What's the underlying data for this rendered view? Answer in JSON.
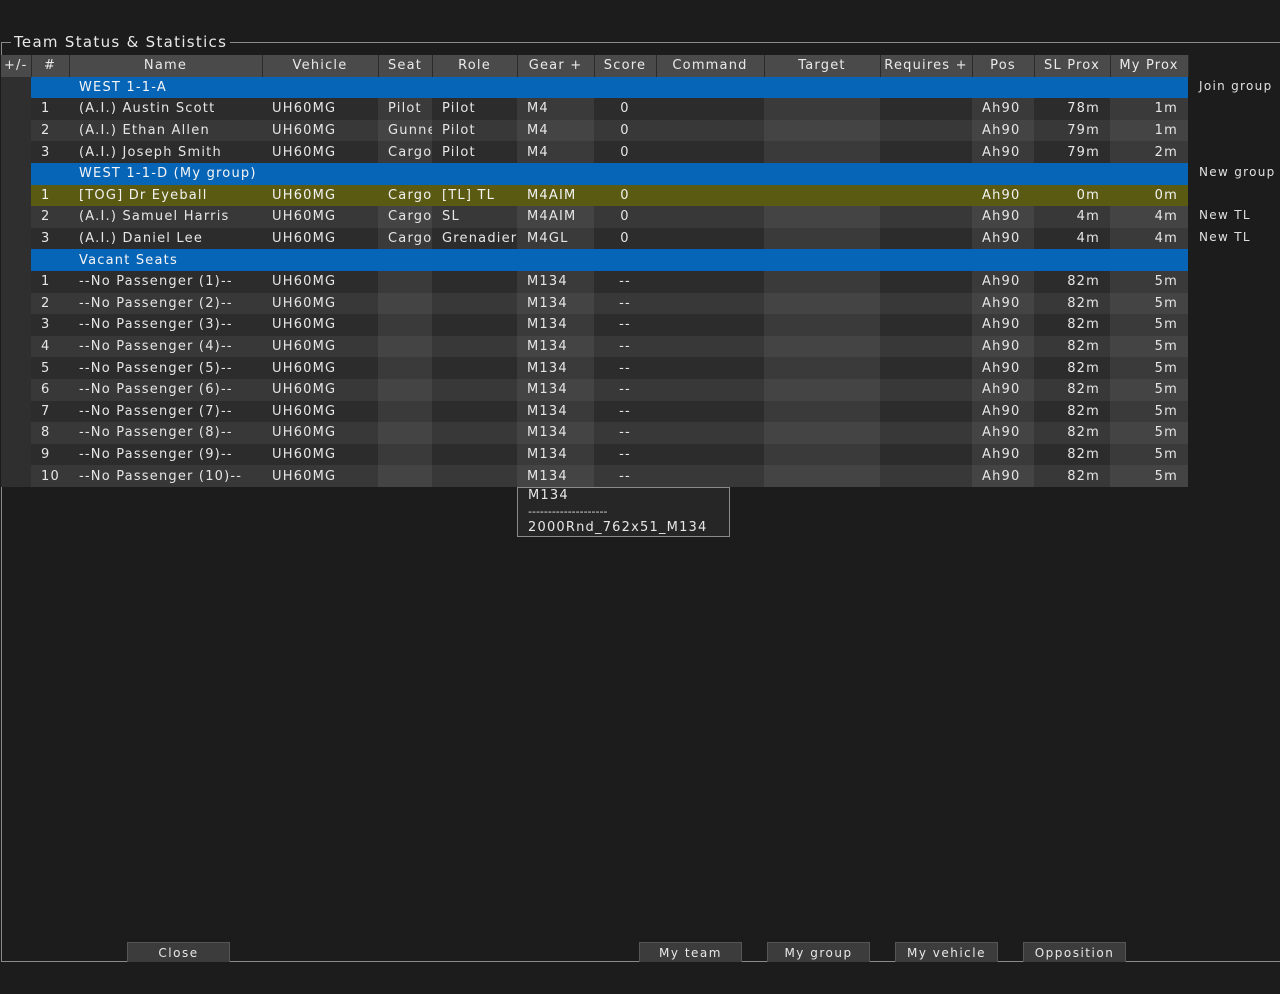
{
  "window": {
    "title": "Team Status & Statistics"
  },
  "columns": [
    "+/-",
    "#",
    "Name",
    "Vehicle",
    "Seat",
    "Role",
    "Gear +",
    "Score",
    "Command",
    "Target",
    "Requires +",
    "Pos",
    "SL Prox",
    "My Prox"
  ],
  "groups": [
    {
      "label": "WEST 1-1-A",
      "action": "Join group",
      "rows": [
        {
          "num": "1",
          "name": "(A.I.) Austin Scott",
          "vehicle": "UH60MG",
          "seat": "Pilot",
          "role": "Pilot",
          "gear": "M4",
          "score": "0",
          "command": "",
          "target": "",
          "requires": "",
          "pos": "Ah90",
          "sl": "78m",
          "my": "1m",
          "action": ""
        },
        {
          "num": "2",
          "name": "(A.I.) Ethan Allen",
          "vehicle": "UH60MG",
          "seat": "Gunne",
          "role": "Pilot",
          "gear": "M4",
          "score": "0",
          "command": "",
          "target": "",
          "requires": "",
          "pos": "Ah90",
          "sl": "79m",
          "my": "1m",
          "action": ""
        },
        {
          "num": "3",
          "name": "(A.I.) Joseph Smith",
          "vehicle": "UH60MG",
          "seat": "Cargo",
          "role": "Pilot",
          "gear": "M4",
          "score": "0",
          "command": "",
          "target": "",
          "requires": "",
          "pos": "Ah90",
          "sl": "79m",
          "my": "2m",
          "action": ""
        }
      ]
    },
    {
      "label": "WEST 1-1-D (My group)",
      "action": "New group",
      "rows": [
        {
          "num": "1",
          "name": "[TOG] Dr Eyeball",
          "vehicle": "UH60MG",
          "seat": "Cargo",
          "role": "[TL] TL",
          "gear": "M4AIM",
          "score": "0",
          "command": "",
          "target": "",
          "requires": "",
          "pos": "Ah90",
          "sl": "0m",
          "my": "0m",
          "action": "",
          "mine": true
        },
        {
          "num": "2",
          "name": "(A.I.) Samuel Harris",
          "vehicle": "UH60MG",
          "seat": "Cargo",
          "role": "SL",
          "gear": "M4AIM",
          "score": "0",
          "command": "",
          "target": "",
          "requires": "",
          "pos": "Ah90",
          "sl": "4m",
          "my": "4m",
          "action": "New TL"
        },
        {
          "num": "3",
          "name": "(A.I.) Daniel Lee",
          "vehicle": "UH60MG",
          "seat": "Cargo",
          "role": "Grenadier",
          "gear": "M4GL",
          "score": "0",
          "command": "",
          "target": "",
          "requires": "",
          "pos": "Ah90",
          "sl": "4m",
          "my": "4m",
          "action": "New TL"
        }
      ]
    },
    {
      "label": "Vacant Seats",
      "action": "",
      "rows": [
        {
          "num": "1",
          "name": "--No Passenger (1)--",
          "vehicle": "UH60MG",
          "seat": "",
          "role": "",
          "gear": "M134",
          "score": "--",
          "command": "",
          "target": "",
          "requires": "",
          "pos": "Ah90",
          "sl": "82m",
          "my": "5m",
          "action": ""
        },
        {
          "num": "2",
          "name": "--No Passenger (2)--",
          "vehicle": "UH60MG",
          "seat": "",
          "role": "",
          "gear": "M134",
          "score": "--",
          "command": "",
          "target": "",
          "requires": "",
          "pos": "Ah90",
          "sl": "82m",
          "my": "5m",
          "action": ""
        },
        {
          "num": "3",
          "name": "--No Passenger (3)--",
          "vehicle": "UH60MG",
          "seat": "",
          "role": "",
          "gear": "M134",
          "score": "--",
          "command": "",
          "target": "",
          "requires": "",
          "pos": "Ah90",
          "sl": "82m",
          "my": "5m",
          "action": ""
        },
        {
          "num": "4",
          "name": "--No Passenger (4)--",
          "vehicle": "UH60MG",
          "seat": "",
          "role": "",
          "gear": "M134",
          "score": "--",
          "command": "",
          "target": "",
          "requires": "",
          "pos": "Ah90",
          "sl": "82m",
          "my": "5m",
          "action": ""
        },
        {
          "num": "5",
          "name": "--No Passenger (5)--",
          "vehicle": "UH60MG",
          "seat": "",
          "role": "",
          "gear": "M134",
          "score": "--",
          "command": "",
          "target": "",
          "requires": "",
          "pos": "Ah90",
          "sl": "82m",
          "my": "5m",
          "action": ""
        },
        {
          "num": "6",
          "name": "--No Passenger (6)--",
          "vehicle": "UH60MG",
          "seat": "",
          "role": "",
          "gear": "M134",
          "score": "--",
          "command": "",
          "target": "",
          "requires": "",
          "pos": "Ah90",
          "sl": "82m",
          "my": "5m",
          "action": ""
        },
        {
          "num": "7",
          "name": "--No Passenger (7)--",
          "vehicle": "UH60MG",
          "seat": "",
          "role": "",
          "gear": "M134",
          "score": "--",
          "command": "",
          "target": "",
          "requires": "",
          "pos": "Ah90",
          "sl": "82m",
          "my": "5m",
          "action": ""
        },
        {
          "num": "8",
          "name": "--No Passenger (8)--",
          "vehicle": "UH60MG",
          "seat": "",
          "role": "",
          "gear": "M134",
          "score": "--",
          "command": "",
          "target": "",
          "requires": "",
          "pos": "Ah90",
          "sl": "82m",
          "my": "5m",
          "action": ""
        },
        {
          "num": "9",
          "name": "--No Passenger (9)--",
          "vehicle": "UH60MG",
          "seat": "",
          "role": "",
          "gear": "M134",
          "score": "--",
          "command": "",
          "target": "",
          "requires": "",
          "pos": "Ah90",
          "sl": "82m",
          "my": "5m",
          "action": ""
        },
        {
          "num": "10",
          "name": "--No Passenger (10)--",
          "vehicle": "UH60MG",
          "seat": "",
          "role": "",
          "gear": "M134",
          "score": "--",
          "command": "",
          "target": "",
          "requires": "",
          "pos": "Ah90",
          "sl": "82m",
          "my": "5m",
          "action": ""
        }
      ]
    }
  ],
  "tooltip": {
    "title": "M134",
    "separator": "--------------------",
    "detail": "2000Rnd_762x51_M134"
  },
  "buttons": {
    "close": "Close",
    "my_team": "My team",
    "my_group": "My group",
    "my_vehicle": "My vehicle",
    "opposition": "Opposition"
  },
  "colors": {
    "group_header": "#0765b8",
    "my_row": "#5b5a12",
    "background": "#1c1c1c"
  }
}
